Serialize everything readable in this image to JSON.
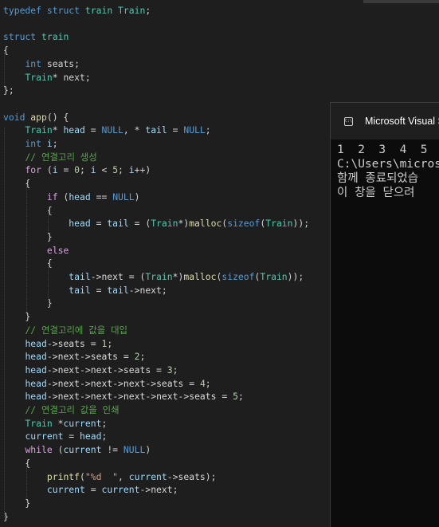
{
  "editor": {
    "lines": [
      [
        [
          "kw",
          "typedef"
        ],
        [
          "pl",
          " "
        ],
        [
          "kw",
          "struct"
        ],
        [
          "pl",
          " "
        ],
        [
          "ty",
          "train"
        ],
        [
          "pl",
          " "
        ],
        [
          "ty",
          "Train"
        ],
        [
          "pl",
          ";"
        ]
      ],
      [],
      [
        [
          "kw",
          "struct"
        ],
        [
          "pl",
          " "
        ],
        [
          "ty",
          "train"
        ]
      ],
      [
        [
          "pl",
          "{"
        ]
      ],
      [
        [
          "pl",
          "    "
        ],
        [
          "kw",
          "int"
        ],
        [
          "pl",
          " seats;"
        ]
      ],
      [
        [
          "pl",
          "    "
        ],
        [
          "ty",
          "Train"
        ],
        [
          "pl",
          "* next;"
        ]
      ],
      [
        [
          "pl",
          "};"
        ]
      ],
      [],
      [
        [
          "kw",
          "void"
        ],
        [
          "pl",
          " "
        ],
        [
          "fn",
          "app"
        ],
        [
          "pl",
          "() {"
        ]
      ],
      [
        [
          "pl",
          "    "
        ],
        [
          "ty",
          "Train"
        ],
        [
          "pl",
          "* "
        ],
        [
          "var",
          "head"
        ],
        [
          "pl",
          " = "
        ],
        [
          "kw",
          "NULL"
        ],
        [
          "pl",
          ", * "
        ],
        [
          "var",
          "tail"
        ],
        [
          "pl",
          " = "
        ],
        [
          "kw",
          "NULL"
        ],
        [
          "pl",
          ";"
        ]
      ],
      [
        [
          "pl",
          "    "
        ],
        [
          "kw",
          "int"
        ],
        [
          "pl",
          " "
        ],
        [
          "var",
          "i"
        ],
        [
          "pl",
          ";"
        ]
      ],
      [
        [
          "pl",
          "    "
        ],
        [
          "cm",
          "// 연결고리 생성"
        ]
      ],
      [
        [
          "pl",
          "    "
        ],
        [
          "ctrl",
          "for"
        ],
        [
          "pl",
          " ("
        ],
        [
          "var",
          "i"
        ],
        [
          "pl",
          " = "
        ],
        [
          "num",
          "0"
        ],
        [
          "pl",
          "; "
        ],
        [
          "var",
          "i"
        ],
        [
          "pl",
          " < "
        ],
        [
          "num",
          "5"
        ],
        [
          "pl",
          "; "
        ],
        [
          "var",
          "i"
        ],
        [
          "pl",
          "++)"
        ]
      ],
      [
        [
          "pl",
          "    {"
        ]
      ],
      [
        [
          "pl",
          "        "
        ],
        [
          "ctrl",
          "if"
        ],
        [
          "pl",
          " ("
        ],
        [
          "var",
          "head"
        ],
        [
          "pl",
          " == "
        ],
        [
          "kw",
          "NULL"
        ],
        [
          "pl",
          ")"
        ]
      ],
      [
        [
          "pl",
          "        {"
        ]
      ],
      [
        [
          "pl",
          "            "
        ],
        [
          "var",
          "head"
        ],
        [
          "pl",
          " = "
        ],
        [
          "var",
          "tail"
        ],
        [
          "pl",
          " = ("
        ],
        [
          "ty",
          "Train"
        ],
        [
          "pl",
          "*)"
        ],
        [
          "fn",
          "malloc"
        ],
        [
          "pl",
          "("
        ],
        [
          "kw",
          "sizeof"
        ],
        [
          "pl",
          "("
        ],
        [
          "ty",
          "Train"
        ],
        [
          "pl",
          "));"
        ]
      ],
      [
        [
          "pl",
          "        }"
        ]
      ],
      [
        [
          "pl",
          "        "
        ],
        [
          "ctrl",
          "else"
        ]
      ],
      [
        [
          "pl",
          "        {"
        ]
      ],
      [
        [
          "pl",
          "            "
        ],
        [
          "var",
          "tail"
        ],
        [
          "pl",
          "->"
        ],
        [
          "mem",
          "next"
        ],
        [
          "pl",
          " = ("
        ],
        [
          "ty",
          "Train"
        ],
        [
          "pl",
          "*)"
        ],
        [
          "fn",
          "malloc"
        ],
        [
          "pl",
          "("
        ],
        [
          "kw",
          "sizeof"
        ],
        [
          "pl",
          "("
        ],
        [
          "ty",
          "Train"
        ],
        [
          "pl",
          "));"
        ]
      ],
      [
        [
          "pl",
          "            "
        ],
        [
          "var",
          "tail"
        ],
        [
          "pl",
          " = "
        ],
        [
          "var",
          "tail"
        ],
        [
          "pl",
          "->"
        ],
        [
          "mem",
          "next"
        ],
        [
          "pl",
          ";"
        ]
      ],
      [
        [
          "pl",
          "        }"
        ]
      ],
      [
        [
          "pl",
          "    }"
        ]
      ],
      [
        [
          "pl",
          "    "
        ],
        [
          "cm",
          "// 연결고리에 값을 대입"
        ]
      ],
      [
        [
          "pl",
          "    "
        ],
        [
          "var",
          "head"
        ],
        [
          "pl",
          "->"
        ],
        [
          "mem",
          "seats"
        ],
        [
          "pl",
          " = "
        ],
        [
          "num",
          "1"
        ],
        [
          "pl",
          ";"
        ]
      ],
      [
        [
          "pl",
          "    "
        ],
        [
          "var",
          "head"
        ],
        [
          "pl",
          "->"
        ],
        [
          "mem",
          "next"
        ],
        [
          "pl",
          "->"
        ],
        [
          "mem",
          "seats"
        ],
        [
          "pl",
          " = "
        ],
        [
          "num",
          "2"
        ],
        [
          "pl",
          ";"
        ]
      ],
      [
        [
          "pl",
          "    "
        ],
        [
          "var",
          "head"
        ],
        [
          "pl",
          "->"
        ],
        [
          "mem",
          "next"
        ],
        [
          "pl",
          "->"
        ],
        [
          "mem",
          "next"
        ],
        [
          "pl",
          "->"
        ],
        [
          "mem",
          "seats"
        ],
        [
          "pl",
          " = "
        ],
        [
          "num",
          "3"
        ],
        [
          "pl",
          ";"
        ]
      ],
      [
        [
          "pl",
          "    "
        ],
        [
          "var",
          "head"
        ],
        [
          "pl",
          "->"
        ],
        [
          "mem",
          "next"
        ],
        [
          "pl",
          "->"
        ],
        [
          "mem",
          "next"
        ],
        [
          "pl",
          "->"
        ],
        [
          "mem",
          "next"
        ],
        [
          "pl",
          "->"
        ],
        [
          "mem",
          "seats"
        ],
        [
          "pl",
          " = "
        ],
        [
          "num",
          "4"
        ],
        [
          "pl",
          ";"
        ]
      ],
      [
        [
          "pl",
          "    "
        ],
        [
          "var",
          "head"
        ],
        [
          "pl",
          "->"
        ],
        [
          "mem",
          "next"
        ],
        [
          "pl",
          "->"
        ],
        [
          "mem",
          "next"
        ],
        [
          "pl",
          "->"
        ],
        [
          "mem",
          "next"
        ],
        [
          "pl",
          "->"
        ],
        [
          "mem",
          "next"
        ],
        [
          "pl",
          "->"
        ],
        [
          "mem",
          "seats"
        ],
        [
          "pl",
          " = "
        ],
        [
          "num",
          "5"
        ],
        [
          "pl",
          ";"
        ]
      ],
      [
        [
          "pl",
          "    "
        ],
        [
          "cm",
          "// 연결고리 값을 인쇄"
        ]
      ],
      [
        [
          "pl",
          "    "
        ],
        [
          "ty",
          "Train"
        ],
        [
          "pl",
          " *"
        ],
        [
          "var",
          "current"
        ],
        [
          "pl",
          ";"
        ]
      ],
      [
        [
          "pl",
          "    "
        ],
        [
          "var",
          "current"
        ],
        [
          "pl",
          " = "
        ],
        [
          "var",
          "head"
        ],
        [
          "pl",
          ";"
        ]
      ],
      [
        [
          "pl",
          "    "
        ],
        [
          "ctrl",
          "while"
        ],
        [
          "pl",
          " ("
        ],
        [
          "var",
          "current"
        ],
        [
          "pl",
          " != "
        ],
        [
          "kw",
          "NULL"
        ],
        [
          "pl",
          ")"
        ]
      ],
      [
        [
          "pl",
          "    {"
        ]
      ],
      [
        [
          "pl",
          "        "
        ],
        [
          "fn",
          "printf"
        ],
        [
          "pl",
          "("
        ],
        [
          "str",
          "\"%d  \""
        ],
        [
          "pl",
          ", "
        ],
        [
          "var",
          "current"
        ],
        [
          "pl",
          "->"
        ],
        [
          "mem",
          "seats"
        ],
        [
          "pl",
          ");"
        ]
      ],
      [
        [
          "pl",
          "        "
        ],
        [
          "var",
          "current"
        ],
        [
          "pl",
          " = "
        ],
        [
          "var",
          "current"
        ],
        [
          "pl",
          "->"
        ],
        [
          "mem",
          "next"
        ],
        [
          "pl",
          ";"
        ]
      ],
      [
        [
          "pl",
          "    }"
        ]
      ],
      [
        [
          "pl",
          "}"
        ]
      ]
    ]
  },
  "console": {
    "icon_name": "console-app-icon",
    "icon_text": "C:\\",
    "title": "Microsoft Visual S",
    "lines": [
      "1  2  3  4  5",
      "C:\\Users\\micros",
      "함께 종료되었습",
      "이 창을 닫으려"
    ]
  },
  "colors": {
    "background": "#1e1e1e",
    "keyword": "#569cd6",
    "control": "#d8a0df",
    "type": "#4ec9b0",
    "function": "#dcdcaa",
    "number": "#b5cea8",
    "string": "#d69d85",
    "comment": "#57a64a",
    "variable": "#9cdcfe",
    "console_bg": "#0c0c0c"
  }
}
